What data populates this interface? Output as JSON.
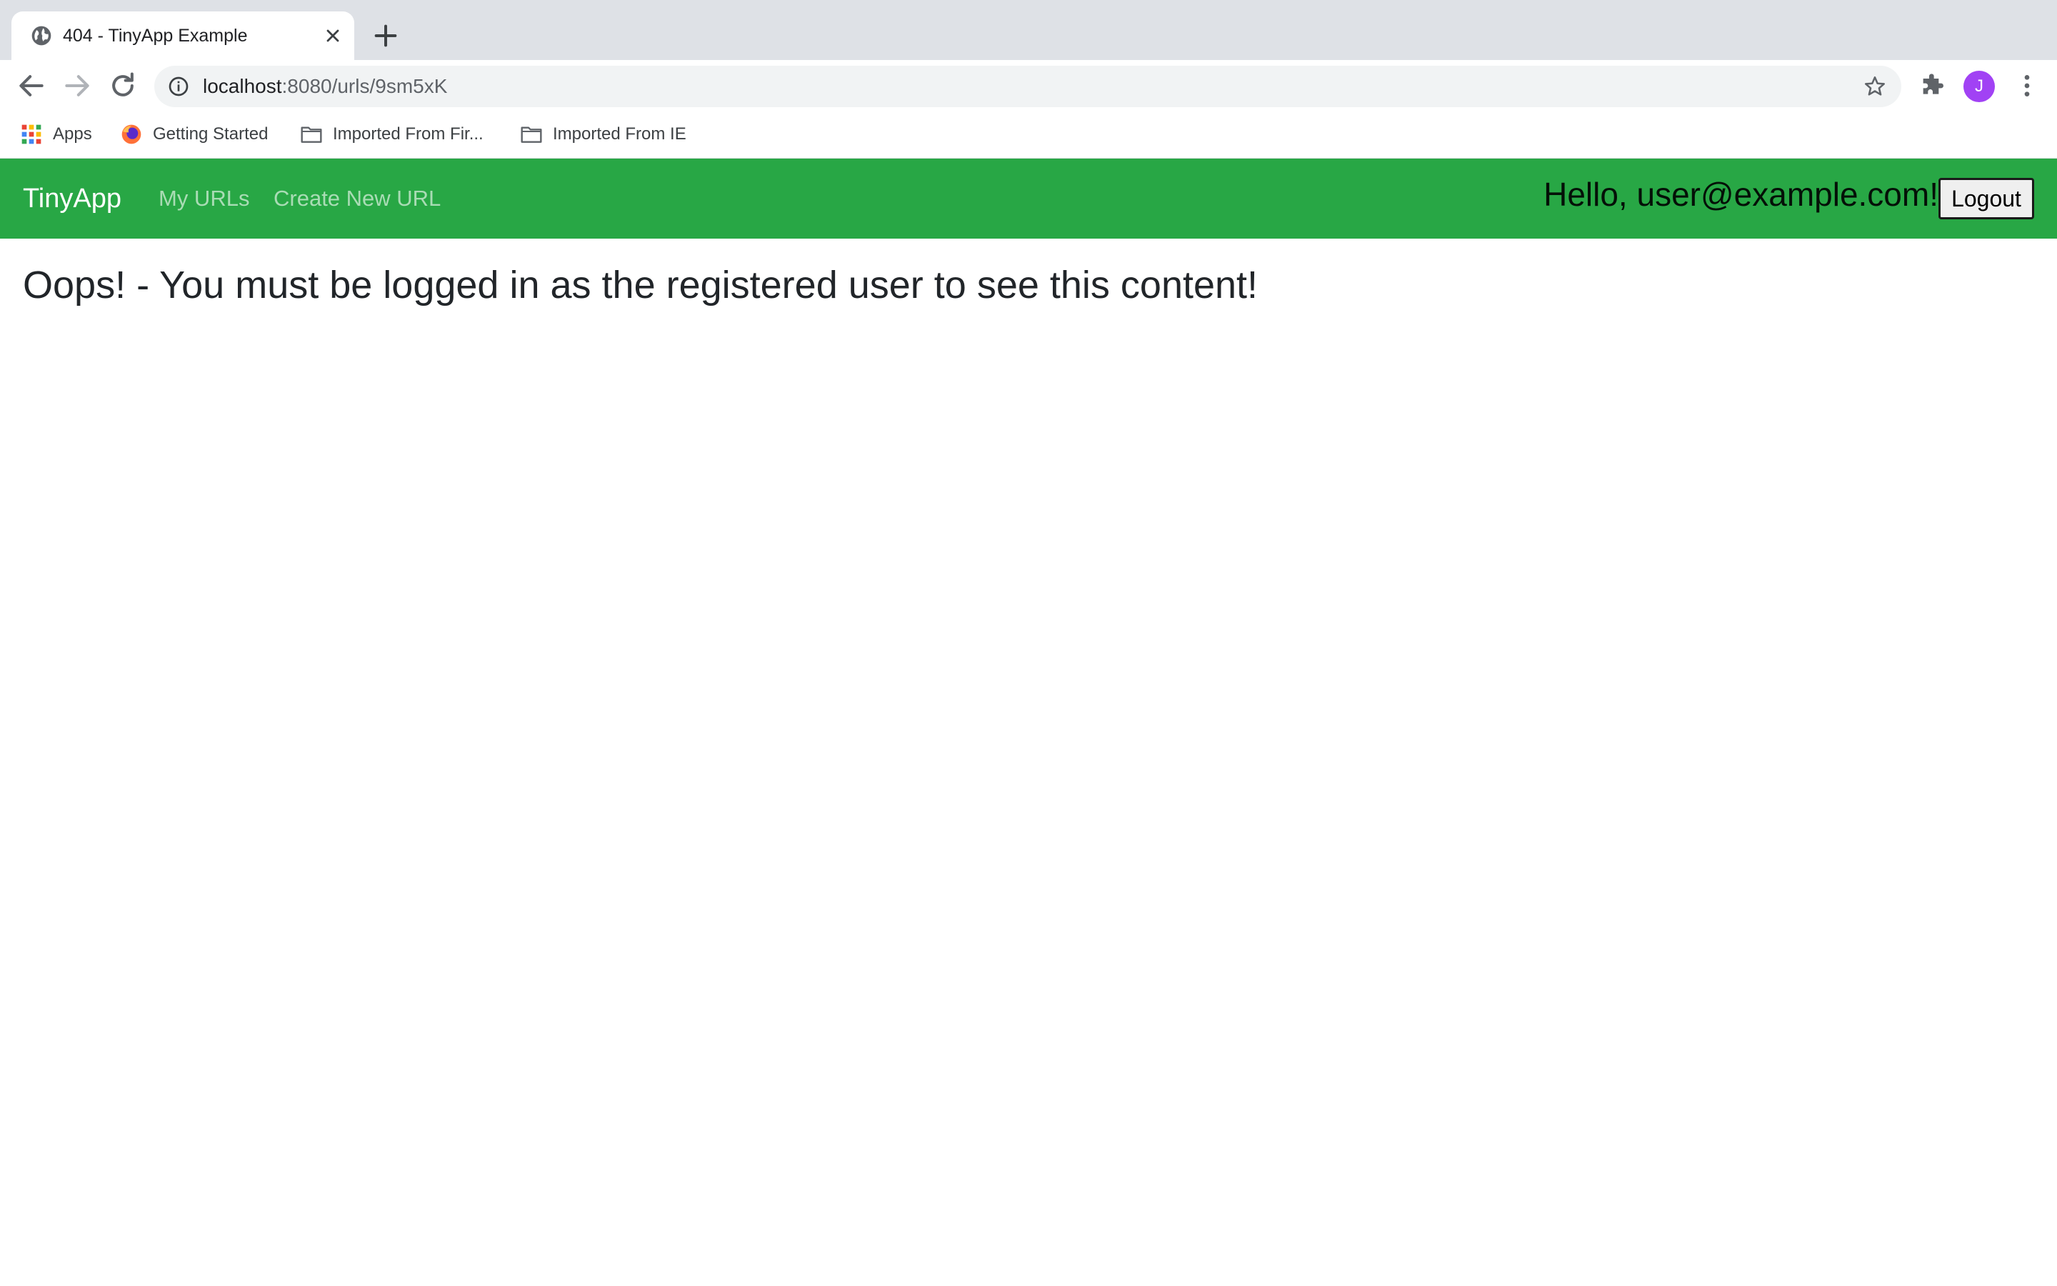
{
  "browser": {
    "tab": {
      "title": "404 - TinyApp Example",
      "favicon": "globe-icon"
    },
    "toolbar": {
      "url_host": "localhost",
      "url_path": ":8080/urls/9sm5xK",
      "profile_initial": "J",
      "profile_color": "#a142f4"
    },
    "bookmarks": [
      {
        "label": "Apps",
        "icon": "apps-grid-icon"
      },
      {
        "label": "Getting Started",
        "icon": "firefox-icon"
      },
      {
        "label": "Imported From Fir...",
        "icon": "folder-icon"
      },
      {
        "label": "Imported From IE",
        "icon": "folder-icon"
      }
    ]
  },
  "app": {
    "brand": "TinyApp",
    "nav": [
      {
        "label": "My URLs"
      },
      {
        "label": "Create New URL"
      }
    ],
    "greeting": "Hello, user@example.com!",
    "logout_label": "Logout",
    "accent_color": "#28a745",
    "message": "Oops! - You must be logged in as the registered user to see this content!"
  }
}
